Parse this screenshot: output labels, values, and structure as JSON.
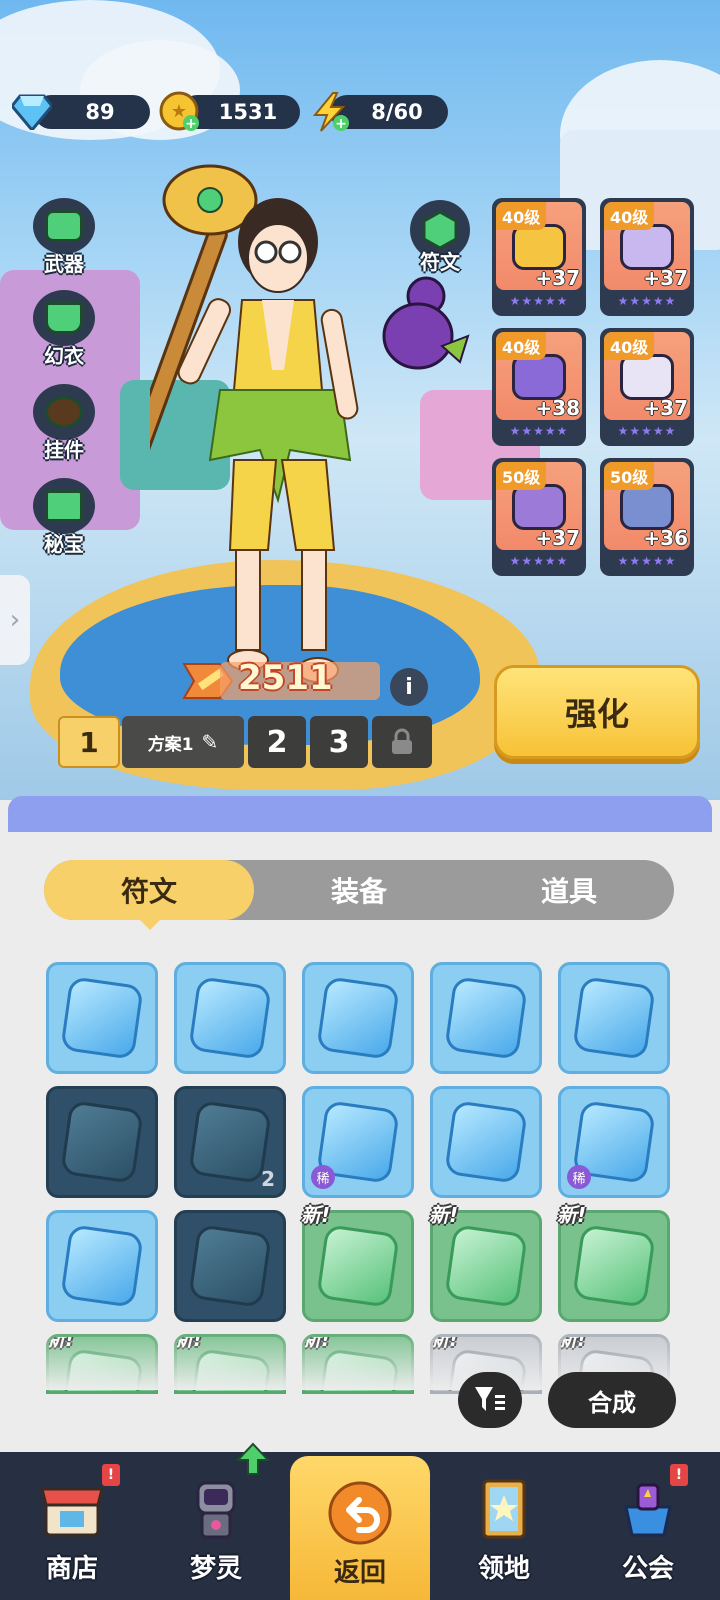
{
  "resources": {
    "diamonds": "89",
    "coins": "1531",
    "stamina": "8/60"
  },
  "side_menu": [
    {
      "label": "武器",
      "icon": "hammer-icon"
    },
    {
      "label": "幻衣",
      "icon": "shirt-icon"
    },
    {
      "label": "挂件",
      "icon": "pendant-icon"
    },
    {
      "label": "秘宝",
      "icon": "treasure-icon"
    }
  ],
  "rune_button": {
    "label": "符文",
    "icon": "hexagon-rune-icon"
  },
  "equipment": [
    {
      "level": "40级",
      "plus": "+37",
      "icon": "helmet-icon",
      "color": "#f5c542"
    },
    {
      "level": "40级",
      "plus": "+37",
      "icon": "armor-icon",
      "color": "#c9b8f0"
    },
    {
      "level": "40级",
      "plus": "+38",
      "icon": "bracer-icon",
      "color": "#8a6ad6"
    },
    {
      "level": "40级",
      "plus": "+37",
      "icon": "pants-icon",
      "color": "#e8e4f5"
    },
    {
      "level": "50级",
      "plus": "+37",
      "icon": "shoes-icon",
      "color": "#9b7ad8"
    },
    {
      "level": "50级",
      "plus": "+36",
      "icon": "gear-orb-icon",
      "color": "#7a8fd0"
    }
  ],
  "power": {
    "value": "2511"
  },
  "plans": {
    "first": "1",
    "scheme_label": "方案1",
    "second": "2",
    "third": "3"
  },
  "enhance_label": "强化",
  "tabs": [
    "符文",
    "装备",
    "道具"
  ],
  "inventory_rows": [
    [
      {
        "style": "blue",
        "icon": "helmet-rune-icon"
      },
      {
        "style": "blue",
        "icon": "armor-rune-icon"
      },
      {
        "style": "blue",
        "icon": "armor-rune-icon"
      },
      {
        "style": "blue",
        "icon": "bracer-rune-icon"
      },
      {
        "style": "blue",
        "icon": "bracer-rune-icon"
      }
    ],
    [
      {
        "style": "dark",
        "icon": "bracer-rune-icon"
      },
      {
        "style": "dark",
        "icon": "pants-rune-icon",
        "count": "2"
      },
      {
        "style": "blue",
        "icon": "shoe-rune-icon",
        "rare": "稀"
      },
      {
        "style": "blue",
        "icon": "shoe-rune-icon"
      },
      {
        "style": "blue",
        "icon": "shoe-rune-icon",
        "rare": "稀"
      }
    ],
    [
      {
        "style": "blue",
        "icon": "glove-rune-icon"
      },
      {
        "style": "dark",
        "icon": "glove-rune-icon"
      },
      {
        "style": "green",
        "icon": "pants-rune-icon",
        "new": "新!"
      },
      {
        "style": "green",
        "icon": "bracer-rune-icon",
        "new": "新!"
      },
      {
        "style": "green",
        "icon": "armor-rune-icon",
        "new": "新!"
      }
    ],
    [
      {
        "style": "green",
        "icon": "rune-icon",
        "new": "新!"
      },
      {
        "style": "green",
        "icon": "rune-icon",
        "new": "新!"
      },
      {
        "style": "green",
        "icon": "rune-icon",
        "new": "新!"
      },
      {
        "style": "grey",
        "icon": "rune-icon",
        "new": "新!"
      },
      {
        "style": "grey",
        "icon": "rune-icon",
        "new": "新!"
      }
    ]
  ],
  "filter_icon": "filter-icon",
  "synthesize_label": "合成",
  "nav": [
    {
      "label": "商店",
      "icon": "shop-icon",
      "badge": "!"
    },
    {
      "label": "梦灵",
      "icon": "robot-icon",
      "badge_icon": "up-arrow-icon"
    },
    {
      "label": "返回",
      "icon": "return-arrow-icon"
    },
    {
      "label": "领地",
      "icon": "territory-door-icon"
    },
    {
      "label": "公会",
      "icon": "guild-trophy-icon",
      "badge": "!"
    }
  ],
  "colors": {
    "accent": "#f7c236",
    "panel": "#ececec",
    "nav_bg": "#263042",
    "tab_active": "#f7d06a"
  }
}
